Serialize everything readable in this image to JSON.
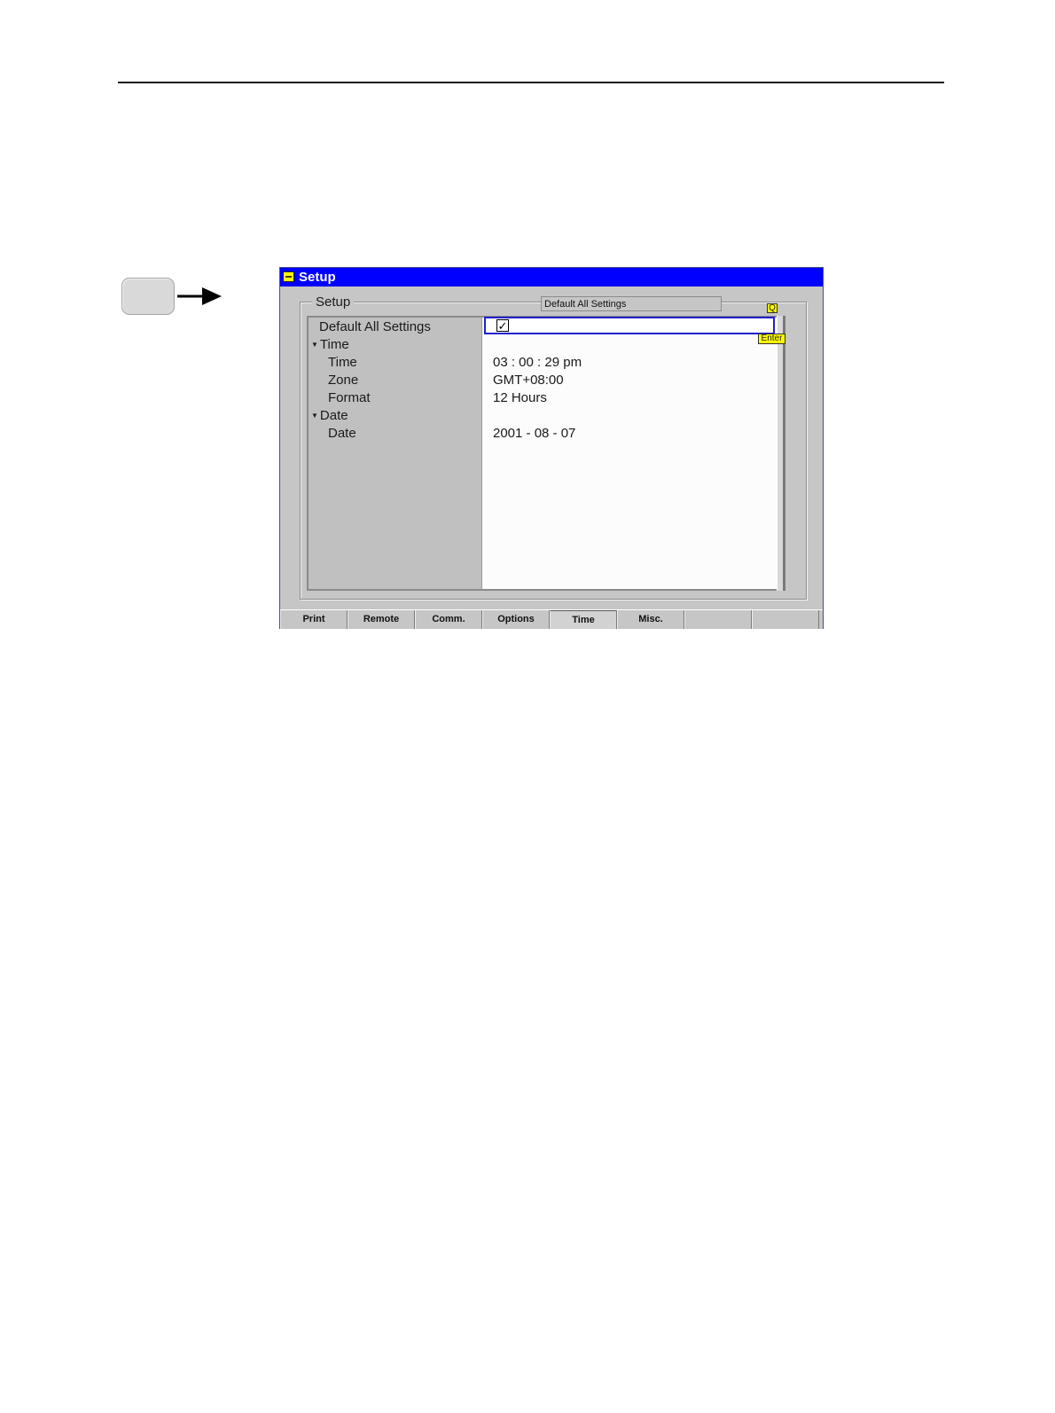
{
  "window": {
    "title": "Setup"
  },
  "group": {
    "legend": "Setup",
    "info": "Default All Settings"
  },
  "tree": [
    {
      "label": "Default All Settings",
      "indent": 0,
      "caret": false
    },
    {
      "label": "Time",
      "indent": 0,
      "caret": true
    },
    {
      "label": "Time",
      "indent": 1,
      "caret": false
    },
    {
      "label": "Zone",
      "indent": 1,
      "caret": false
    },
    {
      "label": "Format",
      "indent": 1,
      "caret": false
    },
    {
      "label": "Date",
      "indent": 0,
      "caret": true
    },
    {
      "label": "Date",
      "indent": 1,
      "caret": false
    }
  ],
  "values": {
    "default_all_settings": "✓",
    "time": "03 : 00 : 29 pm",
    "zone": "GMT+08:00",
    "format": "12 Hours",
    "date": "2001 - 08 - 07"
  },
  "tags": {
    "enter": "Enter",
    "q": "Q"
  },
  "tabs": [
    "Print",
    "Remote",
    "Comm.",
    "Options",
    "Time",
    "Misc.",
    "",
    ""
  ],
  "active_tab": "Time",
  "colors": {
    "titlebar": "#0000ff",
    "tag": "#ffff00",
    "focus": "#2020d0"
  }
}
